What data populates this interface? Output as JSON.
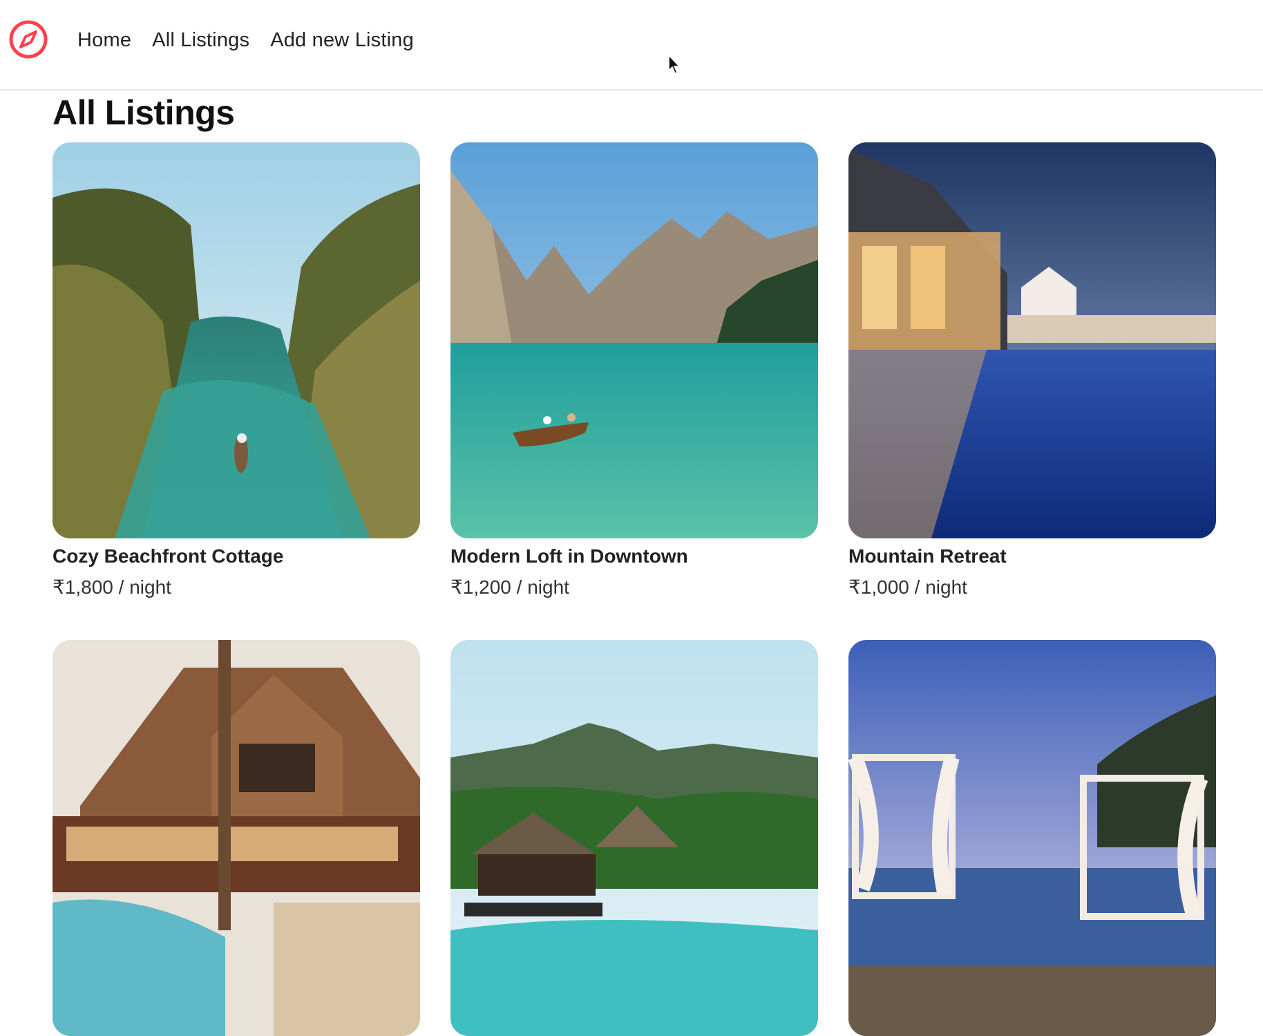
{
  "nav": {
    "links": [
      "Home",
      "All Listings",
      "Add new Listing"
    ]
  },
  "page": {
    "title": "All Listings"
  },
  "listings": [
    {
      "title": "Cozy Beachfront Cottage",
      "price": "₹1,800 / night"
    },
    {
      "title": "Modern Loft in Downtown",
      "price": "₹1,200 / night"
    },
    {
      "title": "Mountain Retreat",
      "price": "₹1,000 / night"
    },
    {
      "title": "",
      "price": ""
    },
    {
      "title": "",
      "price": ""
    },
    {
      "title": "",
      "price": ""
    }
  ],
  "colors": {
    "brand": "#fe424d",
    "text": "#222222",
    "divider": "#e6e6e6"
  },
  "icons": {
    "logo": "compass-icon",
    "cursor": "mouse-pointer-icon"
  }
}
